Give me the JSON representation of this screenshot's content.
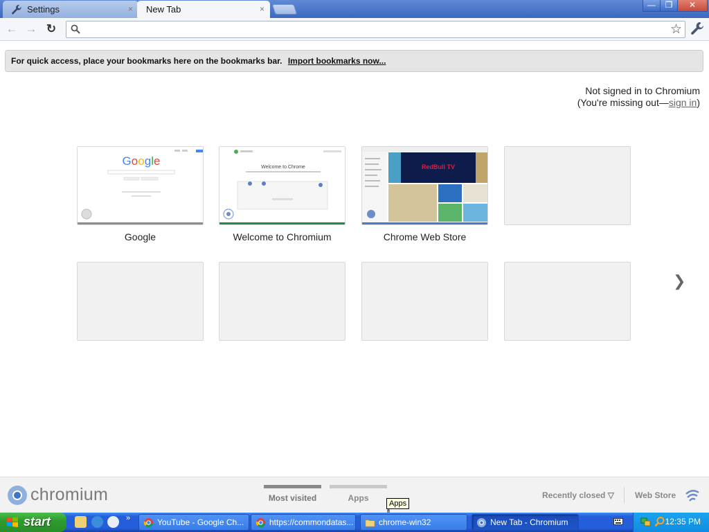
{
  "tabs": {
    "inactive_label": "Settings",
    "active_label": "New Tab",
    "close_glyph": "×"
  },
  "window_controls": {
    "minimize": "—",
    "maximize": "❐",
    "close": "✕"
  },
  "toolbar": {
    "back_glyph": "←",
    "forward_glyph": "→",
    "reload_glyph": "↻",
    "omnibox_value": "",
    "star_glyph": "☆"
  },
  "bookmark_bar": {
    "message": "For quick access, place your bookmarks here on the bookmarks bar.",
    "import_link": "Import bookmarks now..."
  },
  "signin": {
    "line1": "Not signed in to Chromium",
    "line2_prefix": "(You're missing out—",
    "link": "sign in",
    "line2_suffix": ")"
  },
  "most_visited": [
    {
      "label": "Google"
    },
    {
      "label": "Welcome to Chromium"
    },
    {
      "label": "Chrome Web Store"
    }
  ],
  "thumbnail_text": {
    "google_logo": "Google",
    "welcome_heading": "Welcome to Chrome",
    "redbull": "RedBull TV"
  },
  "next_arrow": "❯",
  "footer": {
    "brand": "chromium",
    "tab_most_visited": "Most visited",
    "tab_apps": "Apps",
    "recently_closed": "Recently closed ▽",
    "web_store": "Web Store"
  },
  "tooltip": "Apps",
  "taskbar": {
    "start": "start",
    "more_glyph": "»",
    "buttons": [
      {
        "label": "YouTube - Google Ch..."
      },
      {
        "label": "https://commondatas..."
      },
      {
        "label": "chrome-win32"
      },
      {
        "label": "New Tab - Chromium"
      }
    ],
    "clock": "12:35 PM"
  },
  "colors": {
    "tabstrip": "#3c67c0",
    "taskbar": "#245edb",
    "start_green": "#2f9c2f",
    "google_blue": "#4285f4",
    "google_red": "#ea4335",
    "google_yellow": "#fbbc05",
    "google_green": "#34a853"
  }
}
